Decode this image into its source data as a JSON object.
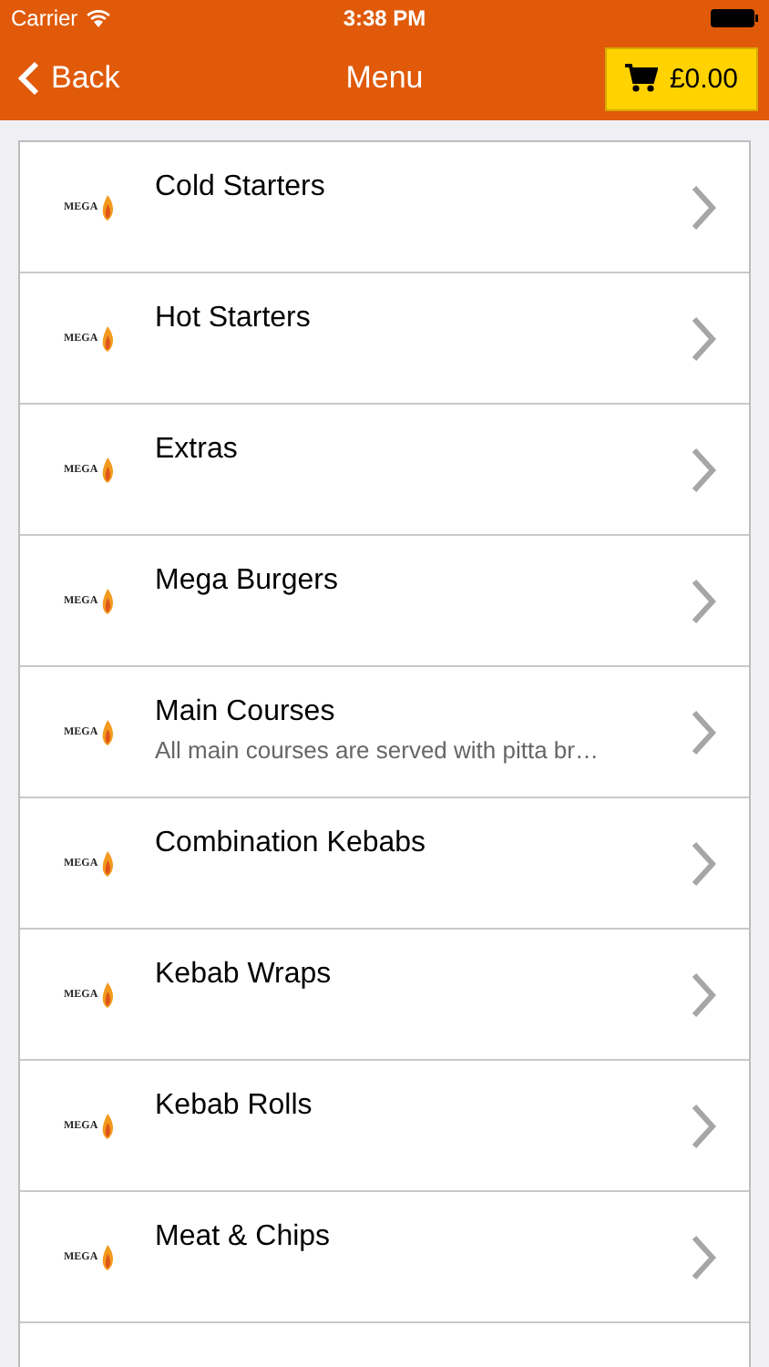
{
  "status_bar": {
    "carrier": "Carrier",
    "time": "3:38 PM"
  },
  "nav": {
    "back": "Back",
    "title": "Menu",
    "cart": "£0.00"
  },
  "categories": [
    {
      "logo": "MEGA",
      "name": "Cold Starters"
    },
    {
      "logo": "MEGA",
      "name": "Hot Starters"
    },
    {
      "logo": "MEGA",
      "name": "Extras"
    },
    {
      "logo": "MEGA",
      "name": "Mega Burgers"
    },
    {
      "logo": "MEGA",
      "name": "Main Courses",
      "description": "All main courses are served with pitta br…"
    },
    {
      "logo": "MEGA",
      "name": "Combination Kebabs"
    },
    {
      "logo": "MEGA",
      "name": "Kebab Wraps"
    },
    {
      "logo": "MEGA",
      "name": "Kebab Rolls"
    },
    {
      "logo": "MEGA",
      "name": "Meat & Chips"
    }
  ]
}
